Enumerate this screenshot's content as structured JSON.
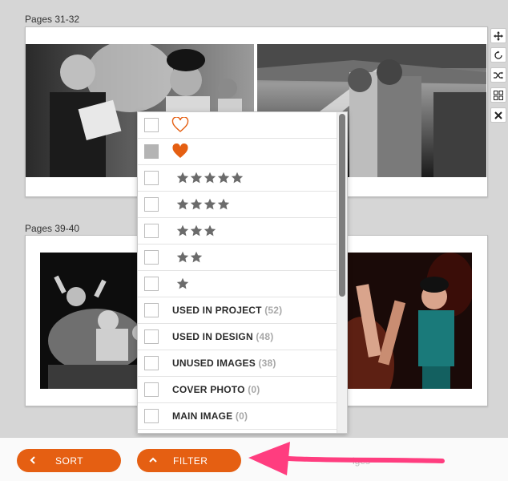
{
  "spreads": [
    {
      "label": "Pages 31-32"
    },
    {
      "label": "Pages 39-40"
    }
  ],
  "toolbar": {
    "icons": [
      "move-icon",
      "rotate-icon",
      "shuffle-icon",
      "grid-icon",
      "close-icon"
    ]
  },
  "filter_menu": {
    "rows": [
      {
        "type": "heart",
        "icon": "heart-outline-icon",
        "checked": false
      },
      {
        "type": "heart",
        "icon": "heart-filled-icon",
        "checked": true
      },
      {
        "type": "rating",
        "stars": 5,
        "checked": false
      },
      {
        "type": "rating",
        "stars": 4,
        "checked": false
      },
      {
        "type": "rating",
        "stars": 3,
        "checked": false
      },
      {
        "type": "rating",
        "stars": 2,
        "checked": false
      },
      {
        "type": "rating",
        "stars": 1,
        "checked": false
      },
      {
        "type": "text",
        "label": "USED IN PROJECT",
        "count": "(52)",
        "checked": false
      },
      {
        "type": "text",
        "label": "USED IN DESIGN",
        "count": "(48)",
        "checked": false
      },
      {
        "type": "text",
        "label": "UNUSED IMAGES",
        "count": "(38)",
        "checked": false
      },
      {
        "type": "text",
        "label": "COVER PHOTO",
        "count": "(0)",
        "checked": false
      },
      {
        "type": "text",
        "label": "MAIN IMAGE",
        "count": "(0)",
        "checked": false
      }
    ]
  },
  "bottom_bar": {
    "sort_label": "SORT",
    "filter_label": "FILTER",
    "faint_text": "iges"
  },
  "colors": {
    "accent": "#e55f12",
    "star": "#6b6b6b",
    "arrow": "#ff3d7f"
  }
}
